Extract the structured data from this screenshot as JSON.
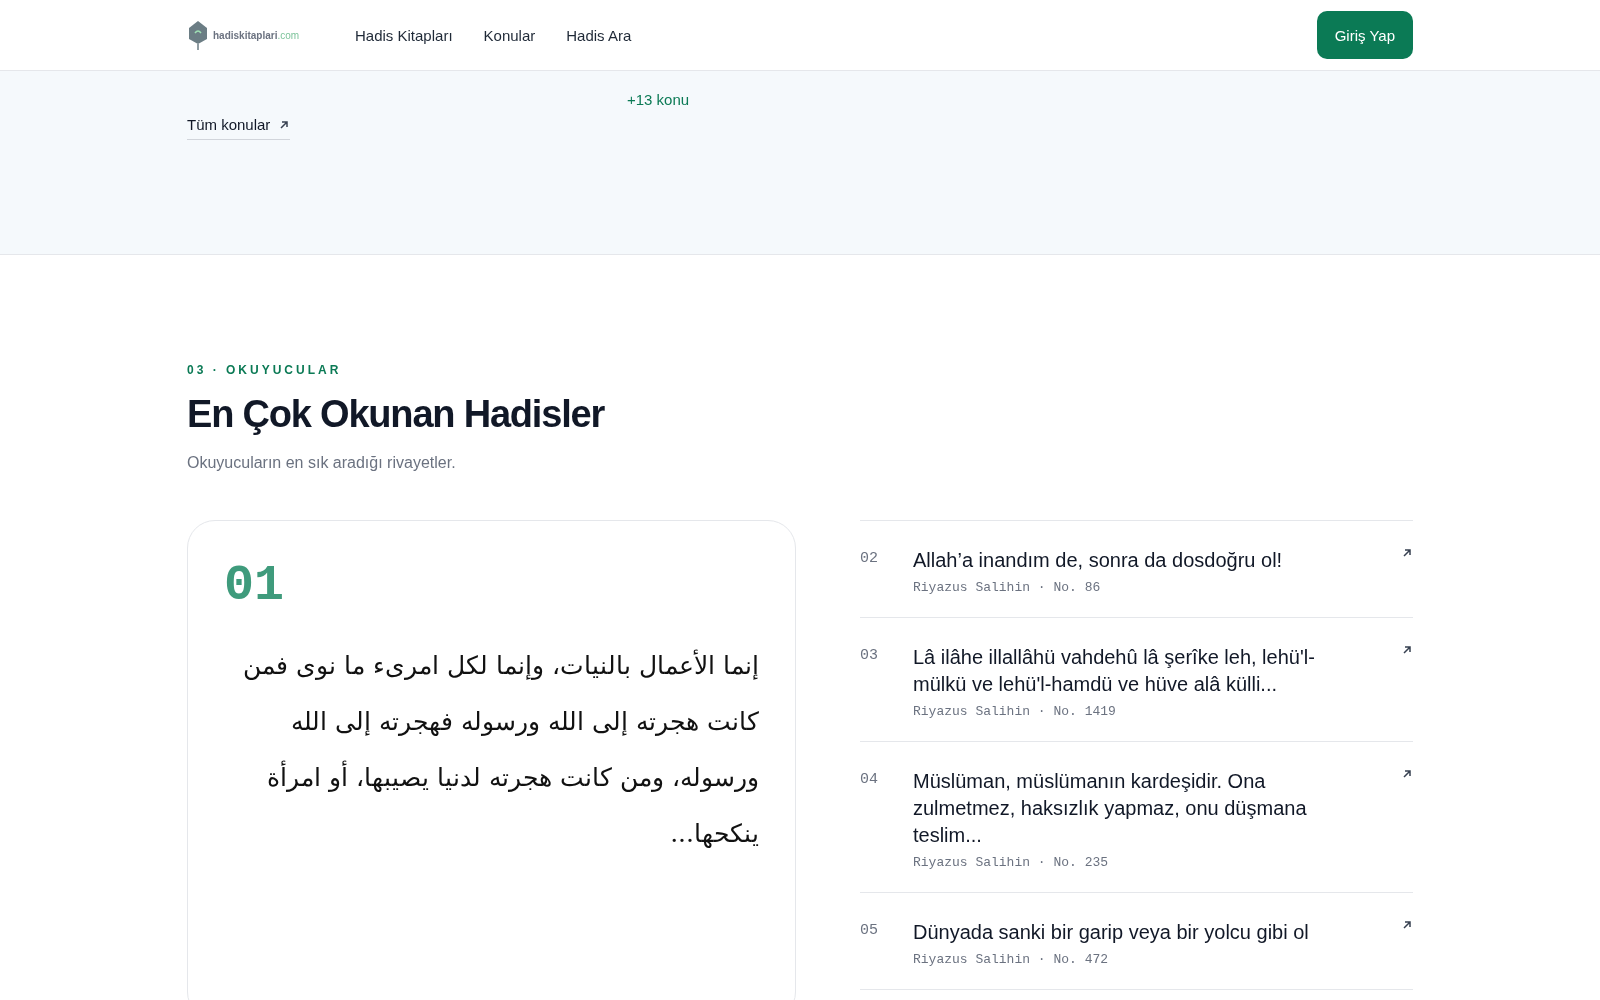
{
  "header": {
    "logo": {
      "name": "hadiskitaplari",
      "suffix": ".com"
    },
    "nav": [
      {
        "label": "Hadis Kitapları"
      },
      {
        "label": "Konular"
      },
      {
        "label": "Hadis Ara"
      }
    ],
    "login_button": "Giriş Yap"
  },
  "topics_section": {
    "all_link": "Tüm konular",
    "more_count": "+13 konu"
  },
  "popular_section": {
    "eyebrow": "03 · OKUYUCULAR",
    "title": "En Çok Okunan Hadisler",
    "subtitle": "Okuyucuların en sık aradığı rivayetler.",
    "featured": {
      "rank": "01",
      "arabic": "إنما الأعمال بالنيات، وإنما لكل امرىء ما نوى فمن كانت هجرته إلى الله ورسوله فهجرته إلى الله ورسوله، ومن كانت هجرته لدنيا يصيبها، أو امرأة ينكحها..."
    },
    "list": [
      {
        "rank": "02",
        "title": "Allah’a inandım de, sonra da dosdoğru ol!",
        "source": "Riyazus Salihin · No. 86"
      },
      {
        "rank": "03",
        "title": "Lâ ilâhe illallâhü vahdehû lâ şerîke leh, lehü'l-mülkü ve lehü'l-hamdü ve hüve alâ külli...",
        "source": "Riyazus Salihin · No. 1419"
      },
      {
        "rank": "04",
        "title": "Müslüman, müslümanın kardeşidir. Ona zulmetmez, haksızlık yapmaz, onu düşmana teslim...",
        "source": "Riyazus Salihin · No. 235"
      },
      {
        "rank": "05",
        "title": "Dünyada sanki bir garip veya bir yolcu gibi ol",
        "source": "Riyazus Salihin · No. 472"
      }
    ]
  }
}
